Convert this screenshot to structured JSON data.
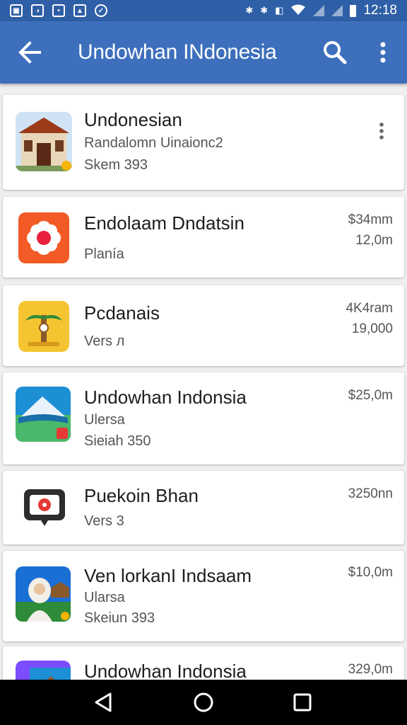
{
  "status_bar": {
    "time": "12:18",
    "left_icons": [
      "photo-icon",
      "message-icon",
      "chat-icon",
      "android-icon",
      "shield-icon"
    ]
  },
  "app_bar": {
    "title": "Undowhan INdonesia"
  },
  "apps": [
    {
      "title": "Undonesian",
      "line1": "Randalomn Uinaionc2",
      "line2": "Skem 393",
      "price1": "",
      "price2": "",
      "icon": "house-icon",
      "accent": "#a9431f",
      "has_menu": true
    },
    {
      "title": "Endolaam Dndatsin",
      "line1": "",
      "line2": "Planía",
      "price1": "$34mm",
      "price2": "12,0m",
      "icon": "flower-icon",
      "accent": "#f25a26",
      "has_menu": false
    },
    {
      "title": "Pcdanais",
      "line1": "",
      "line2": "Vers л",
      "price1": "4K4ram",
      "price2": "19,000",
      "icon": "palm-tree-icon",
      "accent": "#f5c531",
      "has_menu": false
    },
    {
      "title": "Undowhan Indonsia",
      "line1": "Ulersa",
      "line2": "Sieiah 350",
      "price1": "$25,0m",
      "price2": "",
      "icon": "mountain-icon",
      "accent": "#1d8fd4",
      "has_menu": false
    },
    {
      "title": "Puekoin Bhan",
      "line1": "",
      "line2": "Vers 3",
      "price1": "3250nn",
      "price2": "",
      "icon": "camera-icon",
      "accent": "#e53935",
      "has_menu": false
    },
    {
      "title": "Ven lorkanI Indsaam",
      "line1": "Ularsa",
      "line2": "Skeiun 393",
      "price1": "$10,0m",
      "price2": "",
      "icon": "person-icon",
      "accent": "#1a9e4a",
      "has_menu": false
    },
    {
      "title": "Undowhan Indonsia",
      "line1": "",
      "line2": "",
      "price1": "329,0m",
      "price2": "",
      "icon": "landscape-icon",
      "accent": "#7c4dff",
      "has_menu": false
    }
  ],
  "nav": {
    "back": "back-nav-icon",
    "home": "home-nav-icon",
    "recents": "recents-nav-icon"
  }
}
